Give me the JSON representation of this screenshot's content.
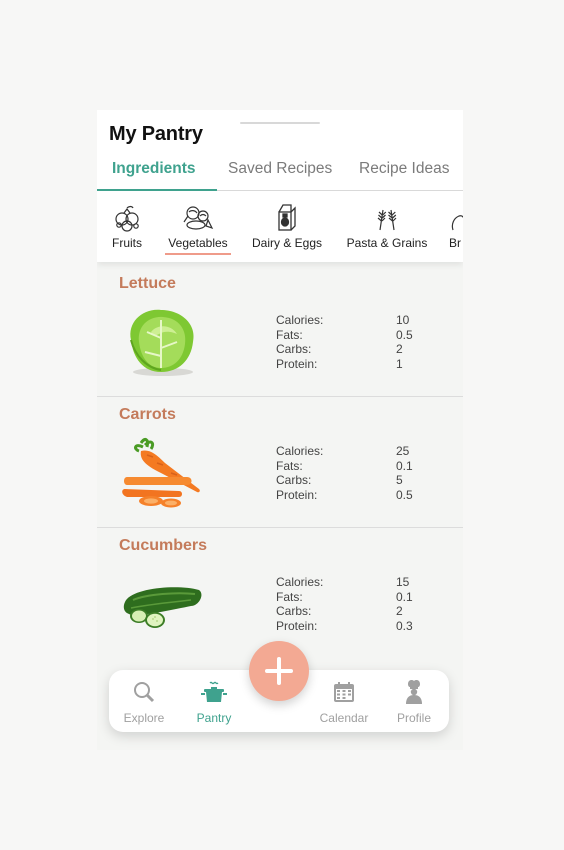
{
  "header": {
    "title": "My Pantry"
  },
  "tabs": [
    {
      "label": "Ingredients",
      "active": true
    },
    {
      "label": "Saved Recipes",
      "active": false
    },
    {
      "label": "Recipe Ideas",
      "active": false
    }
  ],
  "categories": [
    {
      "label": "Fruits",
      "icon": "fruits-icon"
    },
    {
      "label": "Vegetables",
      "icon": "vegetables-icon",
      "active": true
    },
    {
      "label": "Dairy & Eggs",
      "icon": "milk-carton-icon"
    },
    {
      "label": "Pasta & Grains",
      "icon": "wheat-icon"
    },
    {
      "label": "Br",
      "icon": "bread-icon"
    }
  ],
  "nutrition_labels": {
    "calories": "Calories:",
    "fats": "Fats:",
    "carbs": "Carbs:",
    "protein": "Protein:"
  },
  "items": [
    {
      "name": "Lettuce",
      "calories": "10",
      "fats": "0.5",
      "carbs": "2",
      "protein": "1"
    },
    {
      "name": "Carrots",
      "calories": "25",
      "fats": "0.1",
      "carbs": "5",
      "protein": "0.5"
    },
    {
      "name": "Cucumbers",
      "calories": "15",
      "fats": "0.1",
      "carbs": "2",
      "protein": "0.3"
    }
  ],
  "bottom_nav": [
    {
      "label": "Explore",
      "icon": "search-icon"
    },
    {
      "label": "Pantry",
      "icon": "cooking-pot-icon",
      "active": true
    },
    {
      "label": "Calendar",
      "icon": "calendar-icon"
    },
    {
      "label": "Profile",
      "icon": "chef-icon"
    }
  ],
  "fab": {
    "icon": "plus-icon"
  },
  "colors": {
    "accent": "#3fa28e",
    "item_title": "#c47b5b",
    "fab": "#f3a993",
    "category_underline": "#ef9b8a"
  }
}
